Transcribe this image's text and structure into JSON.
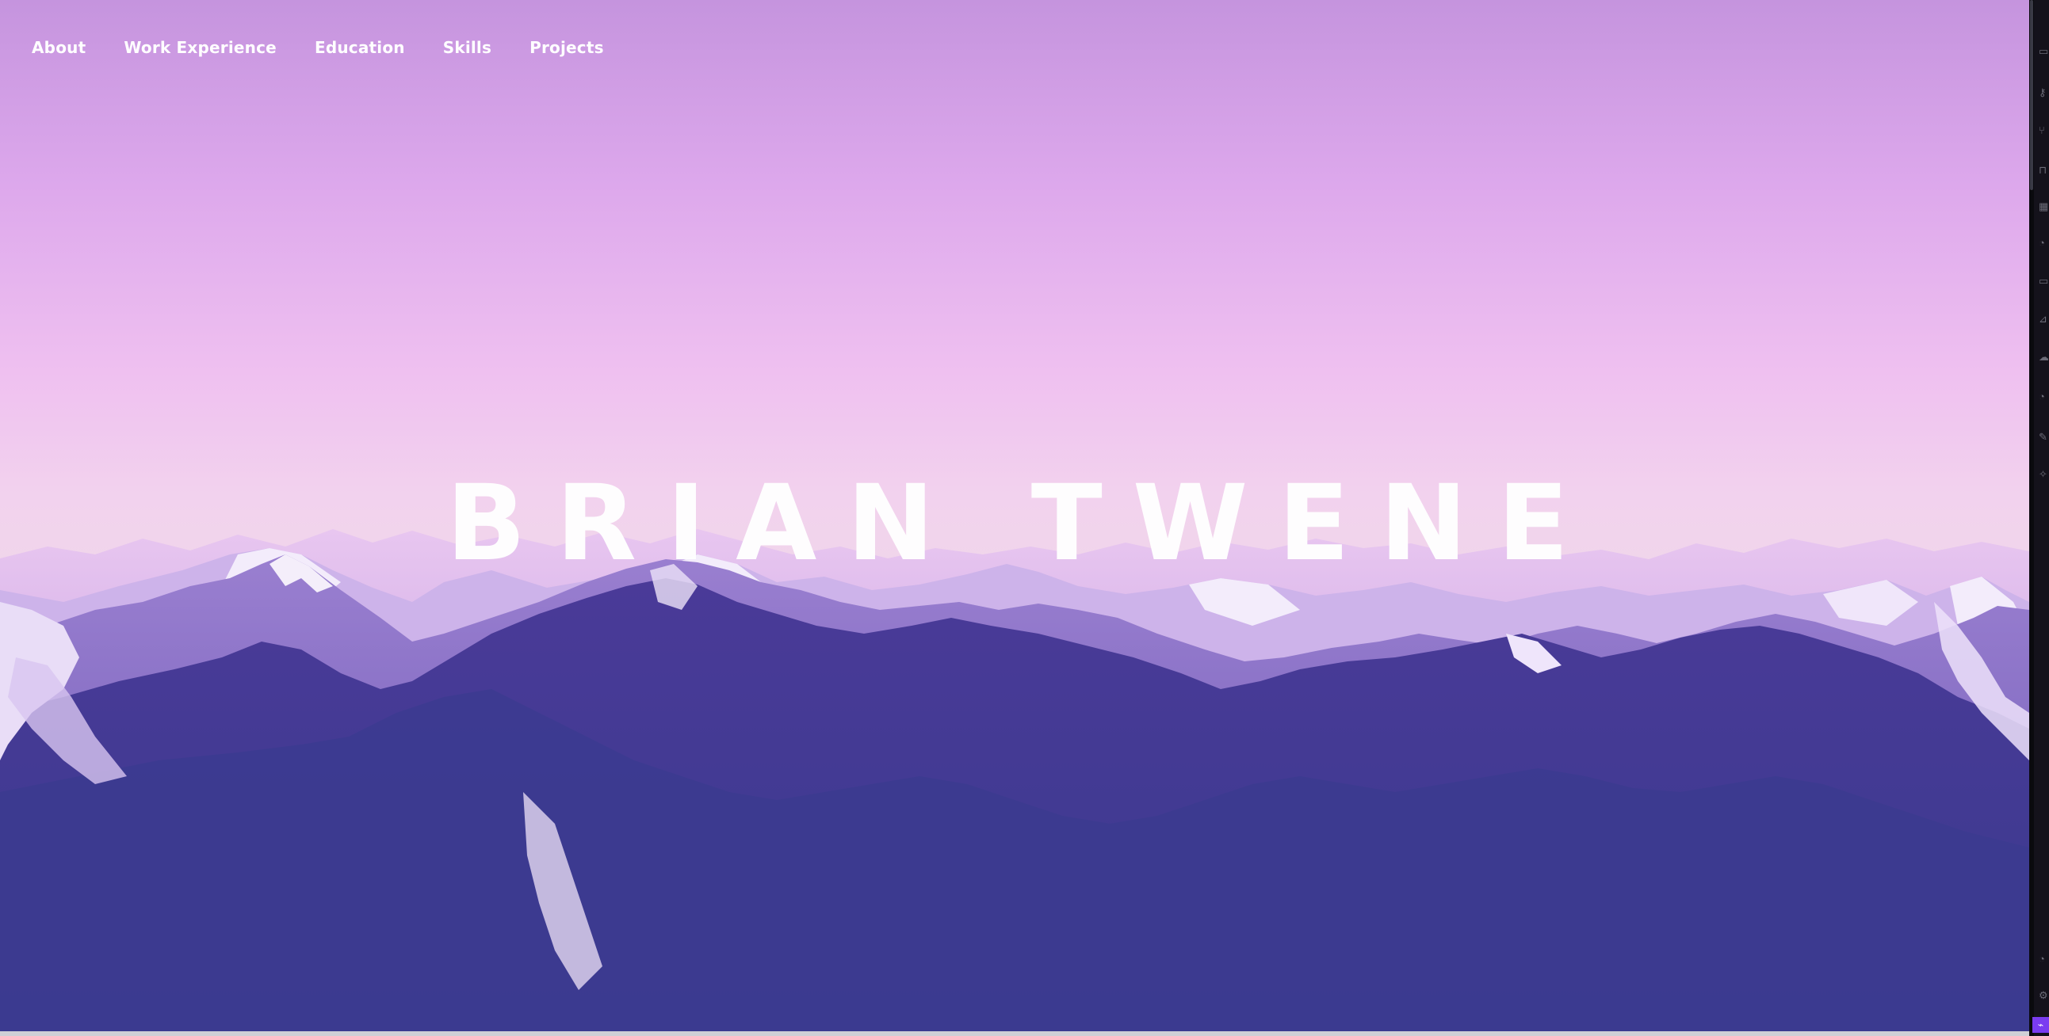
{
  "nav": {
    "items": [
      {
        "label": "About"
      },
      {
        "label": "Work Experience"
      },
      {
        "label": "Education"
      },
      {
        "label": "Skills"
      },
      {
        "label": "Projects"
      }
    ]
  },
  "hero": {
    "title": "BRIAN TWENE"
  },
  "right_bar": {
    "icons": [
      "bookmark-icon",
      "key-icon",
      "branch-icon",
      "lock-icon",
      "grid-icon",
      "info-icon",
      "comment-icon",
      "flask-icon",
      "cloud-icon",
      "help-icon",
      "edit-icon",
      "wand-icon",
      "user-icon",
      "gear-icon"
    ]
  },
  "colors": {
    "sky_top": "#c594de",
    "sky_mid": "#efc0f0",
    "mountain_dark": "#3b2f86",
    "mountain_mid": "#5a4aa8",
    "snow": "#f4eefa",
    "accent": "#7a3cf0"
  }
}
